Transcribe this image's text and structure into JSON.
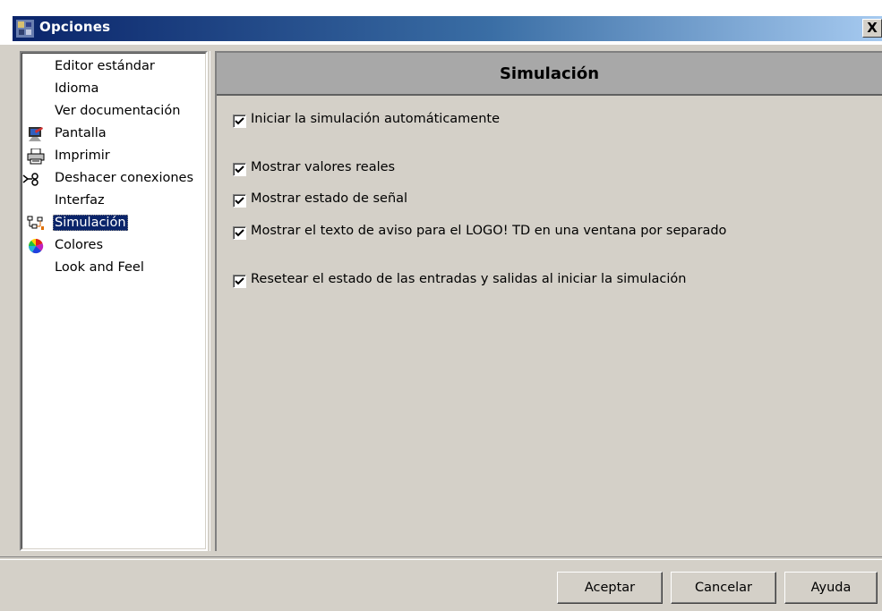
{
  "window": {
    "title": "Opciones",
    "close_glyph": "X"
  },
  "sidebar": {
    "items": [
      {
        "label": "Editor estándar",
        "icon": ""
      },
      {
        "label": "Idioma",
        "icon": ""
      },
      {
        "label": "Ver documentación",
        "icon": ""
      },
      {
        "label": "Pantalla",
        "icon": "display-icon"
      },
      {
        "label": "Imprimir",
        "icon": "printer-icon"
      },
      {
        "label": "Deshacer conexiones",
        "icon": "disconnect-icon"
      },
      {
        "label": "Interfaz",
        "icon": ""
      },
      {
        "label": "Simulación",
        "icon": "simulation-icon",
        "selected": true
      },
      {
        "label": "Colores",
        "icon": "color-wheel-icon"
      },
      {
        "label": "Look and Feel",
        "icon": ""
      }
    ]
  },
  "panel": {
    "title": "Simulación",
    "options": [
      {
        "label": "Iniciar la simulación automáticamente",
        "checked": true
      },
      {
        "label": "Mostrar valores reales",
        "checked": true
      },
      {
        "label": "Mostrar estado de señal",
        "checked": true
      },
      {
        "label": "Mostrar el texto de aviso para el LOGO! TD en una ventana por separado",
        "checked": true
      },
      {
        "label": "Resetear el estado de las entradas y salidas al iniciar la simulación",
        "checked": true
      }
    ]
  },
  "buttons": {
    "ok": "Aceptar",
    "cancel": "Cancelar",
    "help": "Ayuda"
  },
  "colors": {
    "titlebar_start": "#0a246a",
    "titlebar_end": "#a6caf0",
    "face": "#d4d0c8",
    "selection": "#0a246a",
    "header": "#a8a8a8"
  }
}
